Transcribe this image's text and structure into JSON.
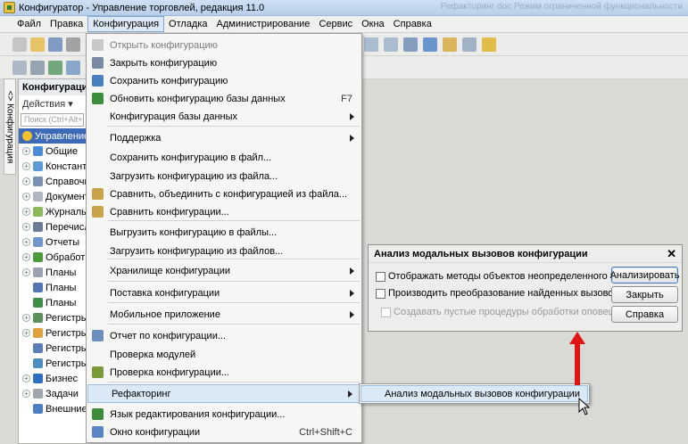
{
  "window": {
    "title": "Конфигуратор - Управление торговлей, редакция 11.0",
    "title_right": "Рефакторинг doc Режим ограниченной функциональности"
  },
  "menubar": {
    "items": [
      "Файл",
      "Правка",
      "Конфигурация",
      "Отладка",
      "Администрирование",
      "Сервис",
      "Окна",
      "Справка"
    ],
    "active_index": 2
  },
  "side_tab": {
    "label": "<> Конфигурация"
  },
  "panel": {
    "header": "Конфигурация",
    "actions": "Действия ▾",
    "search_placeholder": "Поиск (Ctrl+Alt+M)",
    "tree": [
      {
        "label": "Управление",
        "root": true,
        "color": "#f2c12e"
      },
      {
        "label": "Общие",
        "color": "#4b8bd6"
      },
      {
        "label": "Константы",
        "color": "#5c9bd6"
      },
      {
        "label": "Справочники",
        "color": "#7a90b0"
      },
      {
        "label": "Документы",
        "color": "#b0b6bf"
      },
      {
        "label": "Журналы",
        "color": "#8cb85a"
      },
      {
        "label": "Перечисления",
        "color": "#6b7b95"
      },
      {
        "label": "Отчеты",
        "color": "#6f95c9"
      },
      {
        "label": "Обработки",
        "color": "#4e9a3c"
      },
      {
        "label": "Планы",
        "color": "#9aa3b0"
      },
      {
        "label": "Планы",
        "color": "#5376b2",
        "noexp": true
      },
      {
        "label": "Планы",
        "color": "#3f8f4a",
        "noexp": true
      },
      {
        "label": "Регистры",
        "color": "#5c8f5a"
      },
      {
        "label": "Регистры",
        "color": "#e0a040"
      },
      {
        "label": "Регистры",
        "color": "#5a7fb8",
        "noexp": true
      },
      {
        "label": "Регистры",
        "color": "#4c8fbf",
        "noexp": true
      },
      {
        "label": "Бизнес",
        "color": "#2f6fbf"
      },
      {
        "label": "Задачи",
        "color": "#a0a6ae"
      },
      {
        "label": "Внешние",
        "color": "#4d7fc0",
        "noexp": true
      }
    ]
  },
  "dropdown": {
    "items": [
      {
        "label": "Открыть конфигурацию",
        "disabled": true,
        "icon": "#9a9a9a"
      },
      {
        "label": "Закрыть конфигурацию",
        "icon": "#7a8aa0"
      },
      {
        "label": "Сохранить конфигурацию",
        "icon": "#4a7fc0"
      },
      {
        "label": "Обновить конфигурацию базы данных",
        "shortcut": "F7",
        "icon": "#3b8c3b"
      },
      {
        "label": "Конфигурация базы данных",
        "submenu": true
      },
      {
        "label": "Поддержка",
        "submenu": true
      },
      {
        "label": "Сохранить конфигурацию в файл..."
      },
      {
        "label": "Загрузить конфигурацию из файла..."
      },
      {
        "label": "Сравнить, объединить с конфигурацией из файла...",
        "icon": "#c9a34a"
      },
      {
        "label": "Сравнить конфигурации...",
        "icon": "#c9a34a"
      },
      {
        "label": "Выгрузить конфигурацию в файлы..."
      },
      {
        "label": "Загрузить конфигурацию из файлов..."
      },
      {
        "label": "Хранилище конфигурации",
        "submenu": true
      },
      {
        "label": "Поставка конфигурации",
        "submenu": true
      },
      {
        "label": "Мобильное приложение",
        "submenu": true
      },
      {
        "label": "Отчет по конфигурации...",
        "icon": "#6d8fbf"
      },
      {
        "label": "Проверка модулей"
      },
      {
        "label": "Проверка конфигурации...",
        "icon": "#7a9a3a"
      },
      {
        "label": "Рефакторинг",
        "submenu": true,
        "highlighted": true
      },
      {
        "label": "Язык редактирования конфигурации...",
        "icon": "#3c8c3c"
      },
      {
        "label": "Окно конфигурации",
        "shortcut": "Ctrl+Shift+C",
        "icon": "#5a86c4"
      }
    ]
  },
  "submenu": {
    "label": "Анализ модальных вызовов конфигурации"
  },
  "dialog": {
    "title": "Анализ модальных вызовов конфигурации",
    "close": "✕",
    "options": [
      {
        "label": "Отображать методы объектов неопределенного типа",
        "disabled": false
      },
      {
        "label": "Производить преобразование найденных вызовов",
        "disabled": false
      },
      {
        "label": "Создавать пустые процедуры обработки оповещения",
        "disabled": true
      }
    ],
    "buttons": [
      "Анализировать",
      "Закрыть",
      "Справка"
    ]
  }
}
